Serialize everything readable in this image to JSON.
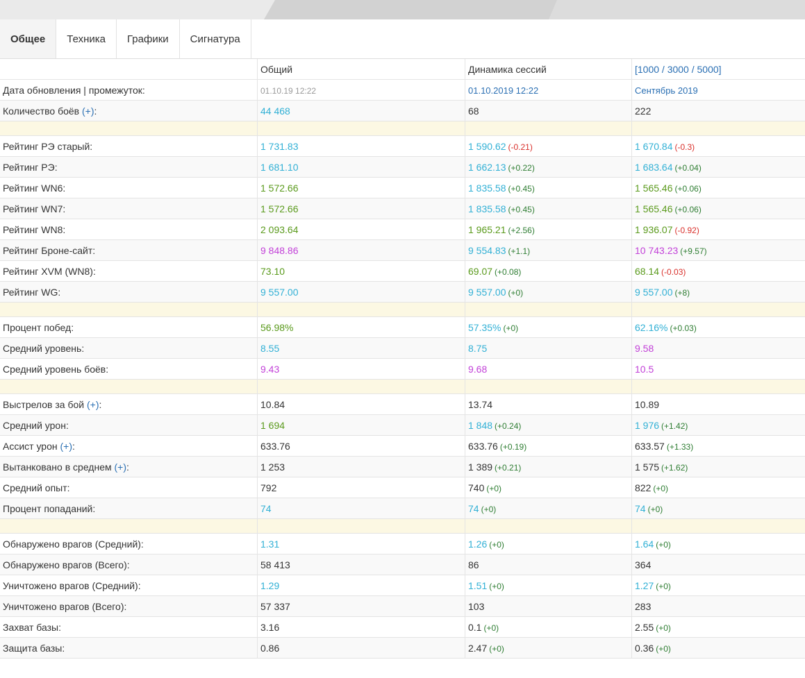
{
  "tabs": [
    "Общее",
    "Техника",
    "Графики",
    "Сигнатура"
  ],
  "headers": [
    "",
    "Общий",
    "Динамика сессий",
    "[1000 / 3000 / 5000]"
  ],
  "plus_label": "(+)",
  "rows": [
    {
      "type": "row",
      "label": "Дата обновления | промежуток:",
      "cells": [
        {
          "v": "01.10.19 12:22",
          "c": "gray"
        },
        {
          "v": "01.10.2019 12:22",
          "c": "linkdate"
        },
        {
          "v": "Сентябрь 2019",
          "c": "linkdate"
        }
      ]
    },
    {
      "type": "row",
      "label": "Количество боёв",
      "plus": true,
      "cells": [
        {
          "v": "44 468",
          "c": "blue"
        },
        {
          "v": "68",
          "c": "dark"
        },
        {
          "v": "222",
          "c": "dark"
        }
      ]
    },
    {
      "type": "sep"
    },
    {
      "type": "row",
      "label": "Рейтинг РЭ старый:",
      "cells": [
        {
          "v": "1 731.83",
          "c": "blue"
        },
        {
          "v": "1 590.62",
          "c": "blue",
          "d": "(-0.21)",
          "dc": "neg"
        },
        {
          "v": "1 670.84",
          "c": "blue",
          "d": "(-0.3)",
          "dc": "neg"
        }
      ]
    },
    {
      "type": "row",
      "label": "Рейтинг РЭ:",
      "cells": [
        {
          "v": "1 681.10",
          "c": "blue"
        },
        {
          "v": "1 662.13",
          "c": "blue",
          "d": "(+0.22)",
          "dc": "pos"
        },
        {
          "v": "1 683.64",
          "c": "blue",
          "d": "(+0.04)",
          "dc": "pos"
        }
      ]
    },
    {
      "type": "row",
      "label": "Рейтинг WN6:",
      "cells": [
        {
          "v": "1 572.66",
          "c": "green"
        },
        {
          "v": "1 835.58",
          "c": "blue",
          "d": "(+0.45)",
          "dc": "pos"
        },
        {
          "v": "1 565.46",
          "c": "green",
          "d": "(+0.06)",
          "dc": "pos"
        }
      ]
    },
    {
      "type": "row",
      "label": "Рейтинг WN7:",
      "cells": [
        {
          "v": "1 572.66",
          "c": "green"
        },
        {
          "v": "1 835.58",
          "c": "blue",
          "d": "(+0.45)",
          "dc": "pos"
        },
        {
          "v": "1 565.46",
          "c": "green",
          "d": "(+0.06)",
          "dc": "pos"
        }
      ]
    },
    {
      "type": "row",
      "label": "Рейтинг WN8:",
      "cells": [
        {
          "v": "2 093.64",
          "c": "green"
        },
        {
          "v": "1 965.21",
          "c": "green",
          "d": "(+2.56)",
          "dc": "pos"
        },
        {
          "v": "1 936.07",
          "c": "green",
          "d": "(-0.92)",
          "dc": "neg"
        }
      ]
    },
    {
      "type": "row",
      "label": "Рейтинг Броне-сайт:",
      "cells": [
        {
          "v": "9 848.86",
          "c": "purple"
        },
        {
          "v": "9 554.83",
          "c": "blue",
          "d": "(+1.1)",
          "dc": "pos"
        },
        {
          "v": "10 743.23",
          "c": "purple",
          "d": "(+9.57)",
          "dc": "pos"
        }
      ]
    },
    {
      "type": "row",
      "label": "Рейтинг XVM (WN8):",
      "cells": [
        {
          "v": "73.10",
          "c": "green"
        },
        {
          "v": "69.07",
          "c": "green",
          "d": "(+0.08)",
          "dc": "pos"
        },
        {
          "v": "68.14",
          "c": "green",
          "d": "(-0.03)",
          "dc": "neg"
        }
      ]
    },
    {
      "type": "row",
      "label": "Рейтинг WG:",
      "cells": [
        {
          "v": "9 557.00",
          "c": "blue"
        },
        {
          "v": "9 557.00",
          "c": "blue",
          "d": "(+0)",
          "dc": "pos"
        },
        {
          "v": "9 557.00",
          "c": "blue",
          "d": "(+8)",
          "dc": "pos"
        }
      ]
    },
    {
      "type": "sep"
    },
    {
      "type": "row",
      "label": "Процент побед:",
      "cells": [
        {
          "v": "56.98%",
          "c": "green"
        },
        {
          "v": "57.35%",
          "c": "blue",
          "d": "(+0)",
          "dc": "pos"
        },
        {
          "v": "62.16%",
          "c": "blue",
          "d": "(+0.03)",
          "dc": "pos"
        }
      ]
    },
    {
      "type": "row",
      "label": "Средний уровень:",
      "cells": [
        {
          "v": "8.55",
          "c": "blue"
        },
        {
          "v": "8.75",
          "c": "blue"
        },
        {
          "v": "9.58",
          "c": "purple"
        }
      ]
    },
    {
      "type": "row",
      "label": "Средний уровень боёв:",
      "cells": [
        {
          "v": "9.43",
          "c": "purple"
        },
        {
          "v": "9.68",
          "c": "purple"
        },
        {
          "v": "10.5",
          "c": "purple"
        }
      ]
    },
    {
      "type": "sep"
    },
    {
      "type": "row",
      "label": "Выстрелов за бой",
      "plus": true,
      "cells": [
        {
          "v": "10.84",
          "c": "dark"
        },
        {
          "v": "13.74",
          "c": "dark"
        },
        {
          "v": "10.89",
          "c": "dark"
        }
      ]
    },
    {
      "type": "row",
      "label": "Средний урон:",
      "cells": [
        {
          "v": "1 694",
          "c": "green"
        },
        {
          "v": "1 848",
          "c": "blue",
          "d": "(+0.24)",
          "dc": "pos"
        },
        {
          "v": "1 976",
          "c": "blue",
          "d": "(+1.42)",
          "dc": "pos"
        }
      ]
    },
    {
      "type": "row",
      "label": "Ассист урон",
      "plus": true,
      "cells": [
        {
          "v": "633.76",
          "c": "dark"
        },
        {
          "v": "633.76",
          "c": "dark",
          "d": "(+0.19)",
          "dc": "pos"
        },
        {
          "v": "633.57",
          "c": "dark",
          "d": "(+1.33)",
          "dc": "pos"
        }
      ]
    },
    {
      "type": "row",
      "label": "Вытанковано в среднем",
      "plus": true,
      "cells": [
        {
          "v": "1 253",
          "c": "dark"
        },
        {
          "v": "1 389",
          "c": "dark",
          "d": "(+0.21)",
          "dc": "pos"
        },
        {
          "v": "1 575",
          "c": "dark",
          "d": "(+1.62)",
          "dc": "pos"
        }
      ]
    },
    {
      "type": "row",
      "label": "Средний опыт:",
      "cells": [
        {
          "v": "792",
          "c": "dark"
        },
        {
          "v": "740",
          "c": "dark",
          "d": "(+0)",
          "dc": "pos"
        },
        {
          "v": "822",
          "c": "dark",
          "d": "(+0)",
          "dc": "pos"
        }
      ]
    },
    {
      "type": "row",
      "label": "Процент попаданий:",
      "cells": [
        {
          "v": "74",
          "c": "blue"
        },
        {
          "v": "74",
          "c": "blue",
          "d": "(+0)",
          "dc": "pos"
        },
        {
          "v": "74",
          "c": "blue",
          "d": "(+0)",
          "dc": "pos"
        }
      ]
    },
    {
      "type": "sep"
    },
    {
      "type": "row",
      "label": "Обнаружено врагов (Средний):",
      "cells": [
        {
          "v": "1.31",
          "c": "blue"
        },
        {
          "v": "1.26",
          "c": "blue",
          "d": "(+0)",
          "dc": "pos"
        },
        {
          "v": "1.64",
          "c": "blue",
          "d": "(+0)",
          "dc": "pos"
        }
      ]
    },
    {
      "type": "row",
      "label": "Обнаружено врагов (Всего):",
      "cells": [
        {
          "v": "58 413",
          "c": "dark"
        },
        {
          "v": "86",
          "c": "dark"
        },
        {
          "v": "364",
          "c": "dark"
        }
      ]
    },
    {
      "type": "row",
      "label": "Уничтожено врагов (Средний):",
      "cells": [
        {
          "v": "1.29",
          "c": "blue"
        },
        {
          "v": "1.51",
          "c": "blue",
          "d": "(+0)",
          "dc": "pos"
        },
        {
          "v": "1.27",
          "c": "blue",
          "d": "(+0)",
          "dc": "pos"
        }
      ]
    },
    {
      "type": "row",
      "label": "Уничтожено врагов (Всего):",
      "cells": [
        {
          "v": "57 337",
          "c": "dark"
        },
        {
          "v": "103",
          "c": "dark"
        },
        {
          "v": "283",
          "c": "dark"
        }
      ]
    },
    {
      "type": "row",
      "label": "Захват базы:",
      "cells": [
        {
          "v": "3.16",
          "c": "dark"
        },
        {
          "v": "0.1",
          "c": "dark",
          "d": "(+0)",
          "dc": "pos"
        },
        {
          "v": "2.55",
          "c": "dark",
          "d": "(+0)",
          "dc": "pos"
        }
      ]
    },
    {
      "type": "row",
      "label": "Защита базы:",
      "cells": [
        {
          "v": "0.86",
          "c": "dark"
        },
        {
          "v": "2.47",
          "c": "dark",
          "d": "(+0)",
          "dc": "pos"
        },
        {
          "v": "0.36",
          "c": "dark",
          "d": "(+0)",
          "dc": "pos"
        }
      ]
    }
  ]
}
